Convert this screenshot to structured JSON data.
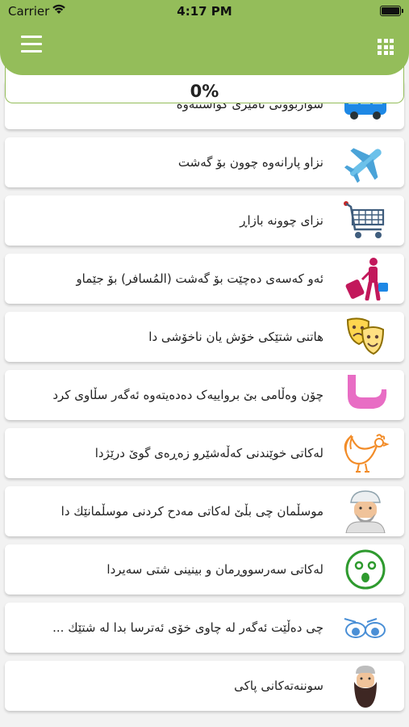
{
  "status_bar": {
    "carrier": "Carrier",
    "time": "4:17 PM"
  },
  "header": {
    "menu_icon": "hamburger-menu-icon",
    "grid_icon": "grid-apps-icon",
    "color": "#94bd5a"
  },
  "progress": {
    "text": "0%",
    "value": 0
  },
  "items": [
    {
      "label": "سواربوونی ئامێری گواستنەوە",
      "icon": "bus-icon"
    },
    {
      "label": "نزاو پارانەوە چوون بۆ گەشت",
      "icon": "airplane-icon"
    },
    {
      "label": "نزای چوونە بازاڕ",
      "icon": "shopping-cart-icon"
    },
    {
      "label": "ئەو کەسەی دەچێت بۆ گەشت (المُسافر) بۆ جێماو",
      "icon": "traveler-icon"
    },
    {
      "label": "هاتنی شتێکی خۆش یان ناخۆشی دا",
      "icon": "theater-masks-icon"
    },
    {
      "label": "چۆن وەڵامی بێ برواییەک دەدەیتەوە ئەگەر سڵاوی کرد",
      "icon": "raised-hand-icon"
    },
    {
      "label": "لەکاتی خوێندنی کەڵەشێرو زەڕەی گوێ درێژدا",
      "icon": "rooster-icon"
    },
    {
      "label": "موسڵمان چی بڵێ لەکاتی مەدح کردنی موسڵمانێك دا",
      "icon": "turban-man-icon"
    },
    {
      "label": "لەکاتی سەرسووڕمان و بینینی شتی سەیردا",
      "icon": "surprised-face-icon"
    },
    {
      "label": "چی دەڵێت ئەگەر لە چاوی خۆی ئەترسا بدا لە شتێك ...",
      "icon": "eyes-icon"
    },
    {
      "label": "سوننەتەکانی پاکی",
      "icon": "bearded-man-icon"
    }
  ]
}
